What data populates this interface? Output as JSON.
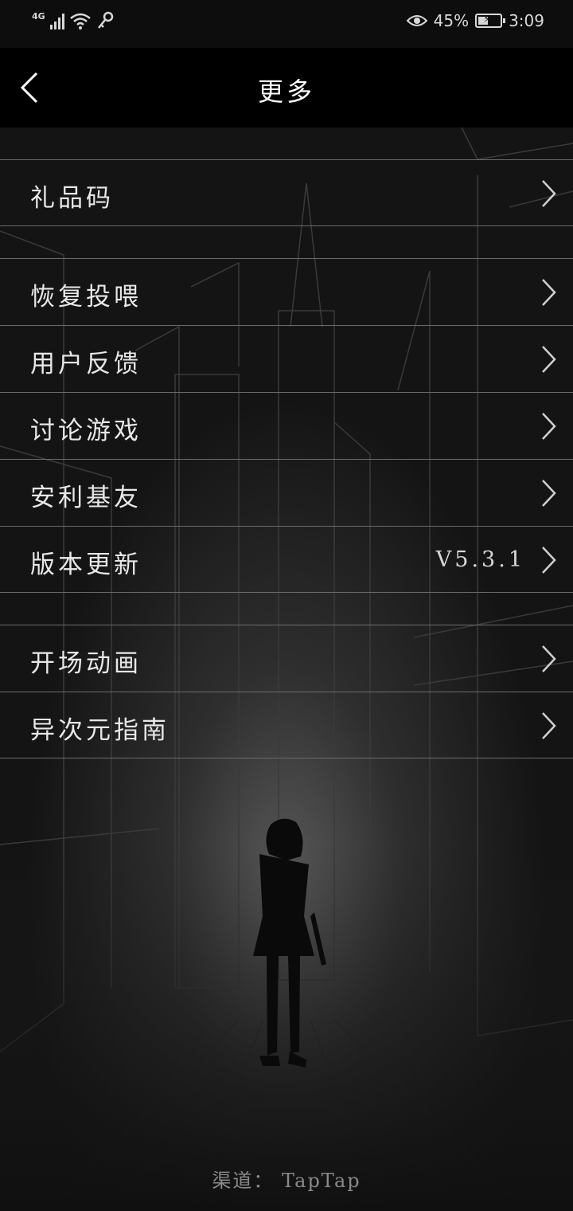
{
  "status_bar": {
    "network": "4G",
    "battery_percent": "45%",
    "battery_level": 0.45,
    "time": "3:09",
    "icons": [
      "signal-icon",
      "wifi-icon",
      "key-icon",
      "eye-icon",
      "battery-charging-icon"
    ]
  },
  "header": {
    "title": "更多",
    "back_icon": "chevron-left-icon"
  },
  "menu": {
    "gift_code": "礼品码",
    "restore_feed": "恢复投喂",
    "feedback": "用户反馈",
    "discuss": "讨论游戏",
    "recommend": "安利基友",
    "version_update": "版本更新",
    "version_value": "V5.3.1",
    "intro_animation": "开场动画",
    "guide": "异次元指南"
  },
  "footer": {
    "channel": "渠道： TapTap"
  },
  "colors": {
    "background": "#141414",
    "header": "#000000",
    "divider": "#6c6c6c",
    "text": "#e6e6e6"
  }
}
